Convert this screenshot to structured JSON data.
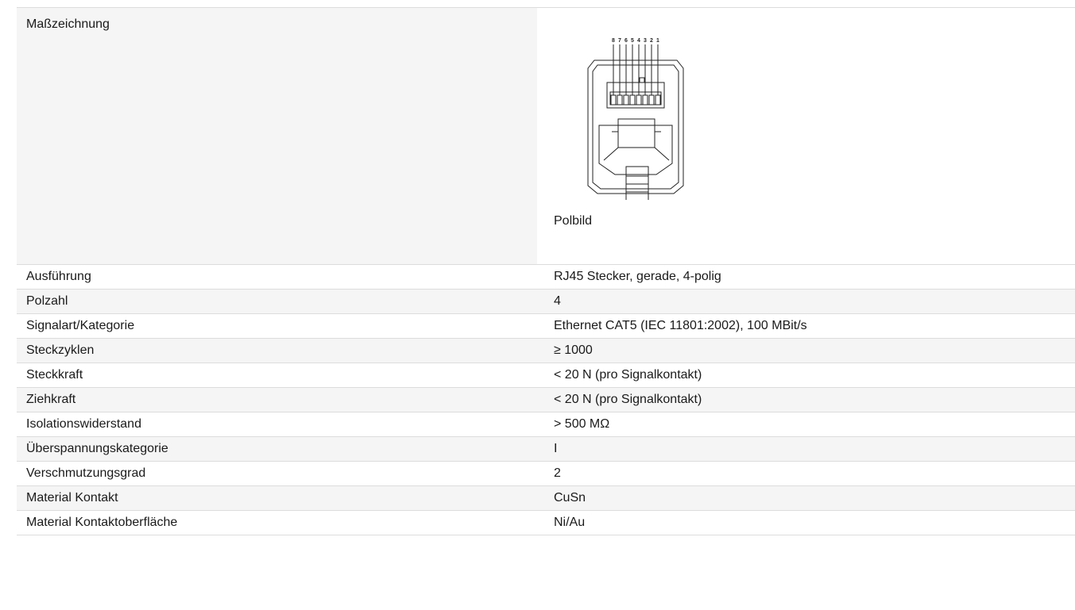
{
  "drawing": {
    "label": "Maßzeichnung",
    "caption": "Polbild",
    "pin_numbers": [
      "8",
      "7",
      "6",
      "5",
      "4",
      "3",
      "2",
      "1"
    ]
  },
  "specs": [
    {
      "label": "Ausführung",
      "value": "RJ45 Stecker, gerade, 4-polig"
    },
    {
      "label": "Polzahl",
      "value": "4"
    },
    {
      "label": "Signalart/Kategorie",
      "value": "Ethernet CAT5 (IEC 11801:2002), 100 MBit/s"
    },
    {
      "label": "Steckzyklen",
      "value": "≥ 1000"
    },
    {
      "label": "Steckkraft",
      "value": "< 20 N (pro Signalkontakt)"
    },
    {
      "label": "Ziehkraft",
      "value": "< 20 N (pro Signalkontakt)"
    },
    {
      "label": "Isolationswiderstand",
      "value": "> 500 MΩ"
    },
    {
      "label": "Überspannungskategorie",
      "value": "I"
    },
    {
      "label": "Verschmutzungsgrad",
      "value": "2"
    },
    {
      "label": "Material Kontakt",
      "value": "CuSn"
    },
    {
      "label": "Material Kontaktoberfläche",
      "value": "Ni/Au"
    }
  ]
}
